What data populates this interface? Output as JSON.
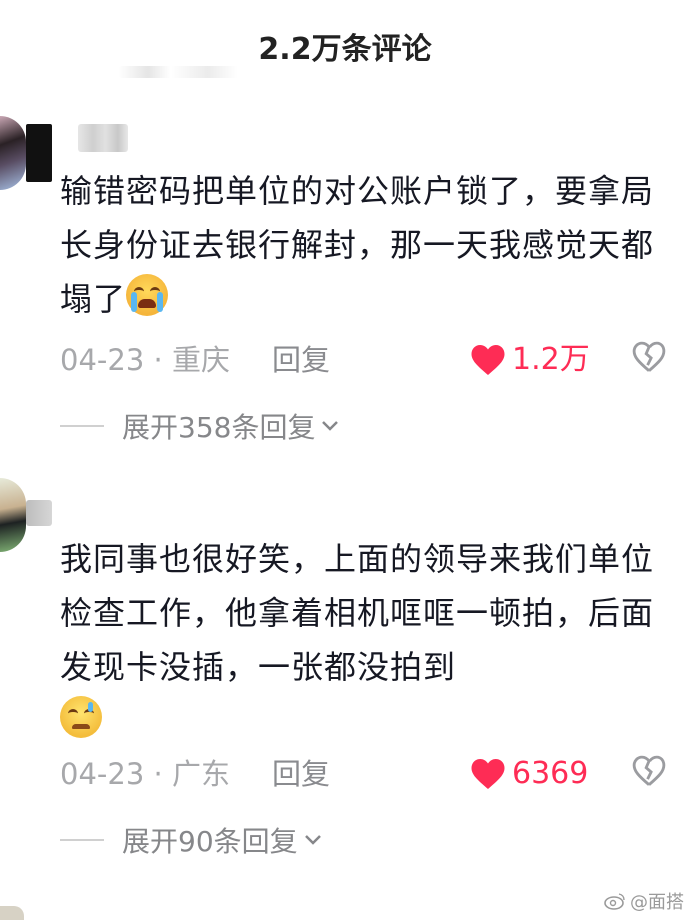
{
  "header": {
    "title": "2.2万条评论"
  },
  "comments": [
    {
      "text": "输错密码把单位的对公账户锁了，要拿局长身份证去银行解封，那一天我感觉天都塌了",
      "emoji": "crying-face-emoji",
      "date": "04-23",
      "separator": "·",
      "location": "重庆",
      "reply_label": "回复",
      "like_count": "1.2万",
      "expand_label": "展开358条回复"
    },
    {
      "text": "我同事也很好笑，上面的领导来我们单位检查工作，他拿着相机哐哐一顿拍，后面发现卡没插，一张都没拍到",
      "emoji": "sweating-face-emoji",
      "date": "04-23",
      "separator": "·",
      "location": "广东",
      "reply_label": "回复",
      "like_count": "6369",
      "expand_label": "展开90条回复"
    }
  ],
  "watermark": {
    "text": "@面搭"
  },
  "colors": {
    "like": "#fe2c55",
    "meta": "#a7a8ab",
    "text": "#161823"
  }
}
